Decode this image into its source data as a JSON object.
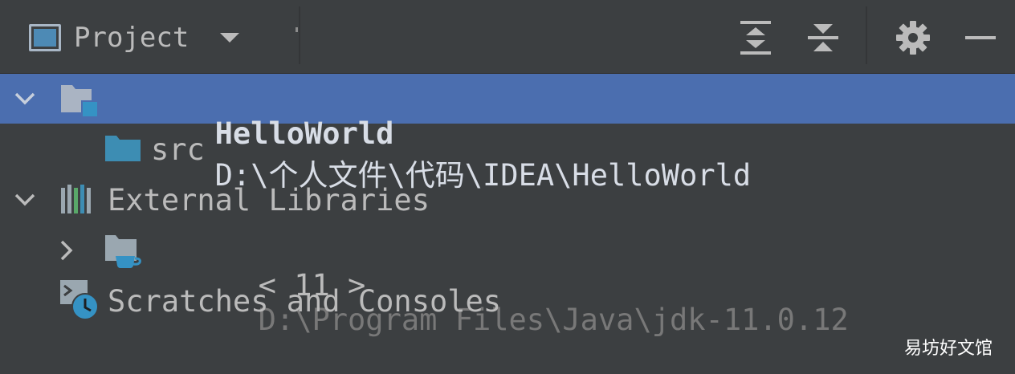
{
  "toolbar": {
    "title": "Project",
    "icons": [
      "project-window-icon",
      "dropdown-chevron-icon",
      "expand-all-icon",
      "collapse-all-icon",
      "gear-icon",
      "minimize-icon"
    ]
  },
  "tree": [
    {
      "name": "HelloWorld",
      "path": "D:\\个人文件\\代码\\IDEA\\HelloWorld",
      "expanded": true,
      "selected": true,
      "icon": "module-folder-icon"
    },
    {
      "name": "src",
      "icon": "source-folder-icon"
    },
    {
      "name": "External Libraries",
      "expanded": true,
      "icon": "libraries-icon"
    },
    {
      "name": "< 11 >",
      "path": "D:\\Program Files\\Java\\jdk-11.0.12",
      "expanded": false,
      "icon": "jdk-folder-icon"
    },
    {
      "name": "Scratches and Consoles",
      "icon": "scratches-icon"
    }
  ],
  "watermark": "易坊好文馆",
  "colors": {
    "panel_bg": "#3c3f41",
    "selection": "#4b6eaf",
    "text": "#bbbbbb",
    "dim_text": "#787878",
    "folder_blue": "#3d8db3"
  }
}
